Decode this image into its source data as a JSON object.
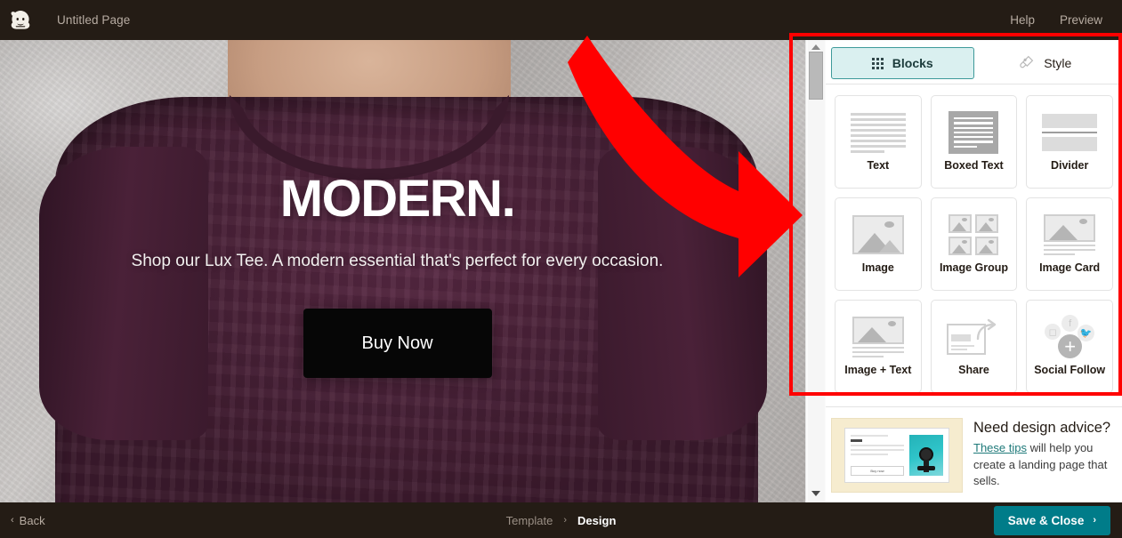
{
  "header": {
    "logo_icon": "mailchimp-freddie-logo",
    "page_title": "Untitled Page",
    "help_label": "Help",
    "preview_label": "Preview"
  },
  "canvas": {
    "hero_title": "MODERN.",
    "hero_subtitle": "Shop our Lux Tee. A modern essential that's perfect for every occasion.",
    "cta_label": "Buy Now"
  },
  "panel": {
    "tabs": [
      {
        "label": "Blocks",
        "icon": "grid-dots-icon",
        "active": true
      },
      {
        "label": "Style",
        "icon": "paintbrush-tag-icon",
        "active": false
      }
    ],
    "blocks": [
      {
        "label": "Text",
        "icon": "text-lines-icon"
      },
      {
        "label": "Boxed Text",
        "icon": "boxed-text-icon"
      },
      {
        "label": "Divider",
        "icon": "divider-icon"
      },
      {
        "label": "Image",
        "icon": "image-icon"
      },
      {
        "label": "Image Group",
        "icon": "image-group-icon"
      },
      {
        "label": "Image Card",
        "icon": "image-card-icon"
      },
      {
        "label": "Image + Text",
        "icon": "image-text-icon"
      },
      {
        "label": "Share",
        "icon": "share-arrow-icon"
      },
      {
        "label": "Social Follow",
        "icon": "social-follow-icon"
      }
    ],
    "advice": {
      "title": "Need design advice?",
      "link_label": "These tips",
      "body_text": " will help you create a landing page that sells.",
      "thumb_button_label": "Buy now"
    }
  },
  "footer": {
    "back_label": "Back",
    "breadcrumb_template": "Template",
    "breadcrumb_separator": "›",
    "breadcrumb_design": "Design",
    "save_label": "Save & Close",
    "save_chevron": "›"
  },
  "annotations": {
    "highlight_color": "#ff0000",
    "arrow_target": "blocks-panel"
  }
}
